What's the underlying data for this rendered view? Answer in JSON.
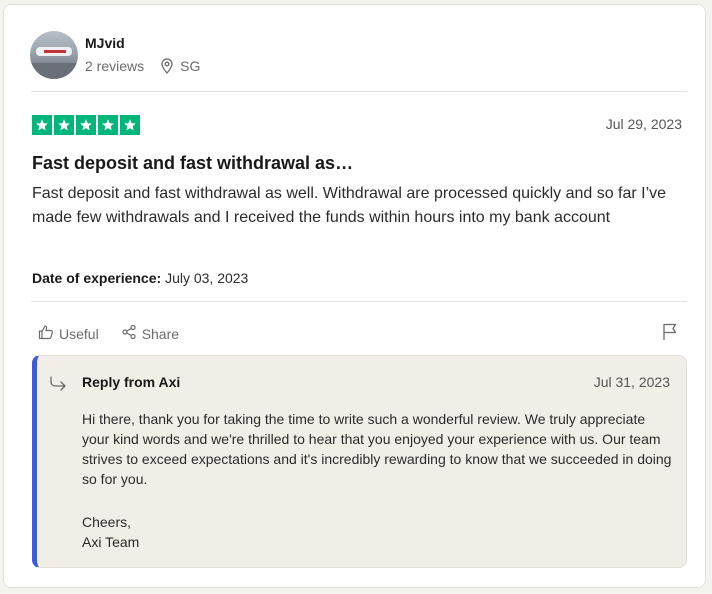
{
  "reviewer": {
    "name": "MJvid",
    "reviews": "2 reviews",
    "location": "SG"
  },
  "review": {
    "rating": 5,
    "rating_max": 5,
    "date": "Jul 29, 2023",
    "title": "Fast deposit and fast withdrawal as…",
    "body": "Fast deposit and fast withdrawal as well. Withdrawal are processed quickly and so far I’ve made few withdrawals and I received the funds within hours into my bank account",
    "experience_label": "Date of experience:",
    "experience_date": "July 03, 2023"
  },
  "actions": {
    "useful_label": "Useful",
    "share_label": "Share"
  },
  "reply": {
    "from": "Reply from Axi",
    "date": "Jul 31, 2023",
    "text": "Hi there, thank you for taking the time to write such a wonderful review. We truly appreciate your kind words and we're thrilled to hear that you enjoyed your experience with us. Our team strives to exceed expectations and it's incredibly rewarding to know that we succeeded in doing so for you.",
    "sign_line1": "Cheers,",
    "sign_line2": "Axi Team"
  },
  "colors": {
    "star_green": "#00b67a",
    "reply_accent": "#3b5bdb",
    "reply_bg": "#f0eee6"
  },
  "icons": [
    "location-pin-icon",
    "star-icon",
    "thumbs-up-icon",
    "share-icon",
    "flag-icon",
    "reply-arrow-icon"
  ]
}
